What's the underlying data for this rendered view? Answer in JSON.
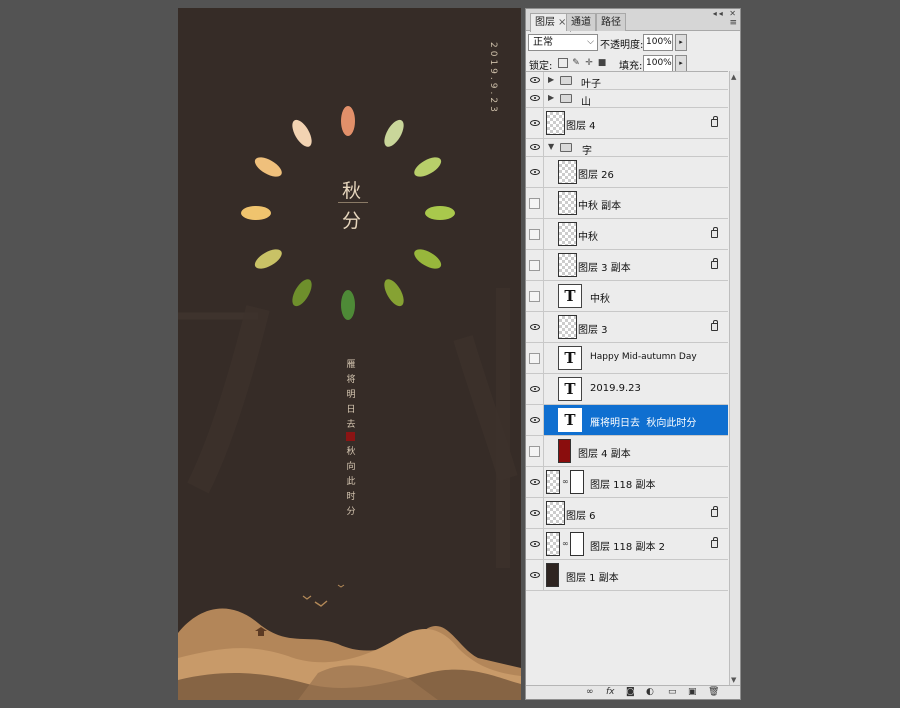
{
  "poster": {
    "date": "2019.9.23",
    "title_top": "秋",
    "title_bottom": "分",
    "poem_line1": "雁将明日去",
    "poem_line2": "秋向此时分"
  },
  "panel": {
    "tabs": [
      "图层",
      "通道",
      "路径"
    ],
    "blend_mode": "正常",
    "opacity_label": "不透明度:",
    "opacity_value": "100%",
    "lock_label": "锁定:",
    "fill_label": "填充:",
    "fill_value": "100%"
  },
  "layers": [
    {
      "name": "叶子",
      "kind": "group",
      "visible": true,
      "expanded": false
    },
    {
      "name": "山",
      "kind": "group",
      "visible": true,
      "expanded": false
    },
    {
      "name": "图层 4",
      "kind": "pixel",
      "visible": true,
      "locked": true
    },
    {
      "name": "字",
      "kind": "group",
      "visible": true,
      "expanded": true
    },
    {
      "name": "图层 26",
      "kind": "pixel",
      "visible": true,
      "locked": false
    },
    {
      "name": "中秋 副本",
      "kind": "pixel",
      "visible": false,
      "locked": false
    },
    {
      "name": "中秋",
      "kind": "pixel",
      "visible": false,
      "locked": true
    },
    {
      "name": "图层 3 副本",
      "kind": "pixel",
      "visible": false,
      "locked": true
    },
    {
      "name": "中秋",
      "kind": "text",
      "visible": false
    },
    {
      "name": "图层 3",
      "kind": "pixel",
      "visible": true,
      "locked": true
    },
    {
      "name": "Happy Mid-autumn Day",
      "kind": "text",
      "visible": false
    },
    {
      "name": "2019.9.23",
      "kind": "text",
      "visible": true
    },
    {
      "name": "雁将明日去  秋向此时分",
      "kind": "text",
      "visible": true,
      "selected": true
    },
    {
      "name": "图层 4 副本",
      "kind": "fill-red",
      "visible": false
    },
    {
      "name": "图层 118 副本",
      "kind": "masked",
      "visible": true
    },
    {
      "name": "图层 6",
      "kind": "pixel",
      "visible": true,
      "locked": true
    },
    {
      "name": "图层 118 副本 2",
      "kind": "masked",
      "visible": true,
      "locked": true
    },
    {
      "name": "图层 1 副本",
      "kind": "fill-dark",
      "visible": true
    }
  ],
  "colors": {
    "canvas_bg": "#362c27",
    "selection": "#0f6fd0",
    "seal_red": "#8b1414",
    "mountain": "#b98a5b"
  },
  "icons": [
    "eye-icon",
    "folder-icon",
    "lock-icon",
    "link-icon",
    "fx-icon",
    "mask-icon",
    "adjustment-icon",
    "new-group-icon",
    "new-layer-icon",
    "trash-icon"
  ]
}
